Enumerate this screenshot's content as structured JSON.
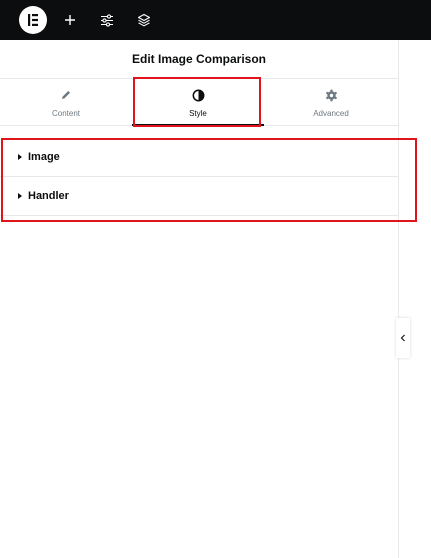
{
  "topbar": {
    "icons": [
      "elementor-logo-icon",
      "plus-icon",
      "sliders-icon",
      "layers-icon"
    ]
  },
  "panel": {
    "title": "Edit Image Comparison",
    "tabs": [
      {
        "label": "Content",
        "icon": "pencil-icon"
      },
      {
        "label": "Style",
        "icon": "contrast-icon"
      },
      {
        "label": "Advanced",
        "icon": "gear-icon"
      }
    ],
    "active_tab": "Style",
    "sections": [
      {
        "label": "Image"
      },
      {
        "label": "Handler"
      }
    ]
  },
  "colors": {
    "topbar": "#0c0d0e",
    "text": "#0c0d0e",
    "muted": "#6d7882",
    "border": "#e6e8ea",
    "highlight": "#e0151c"
  }
}
